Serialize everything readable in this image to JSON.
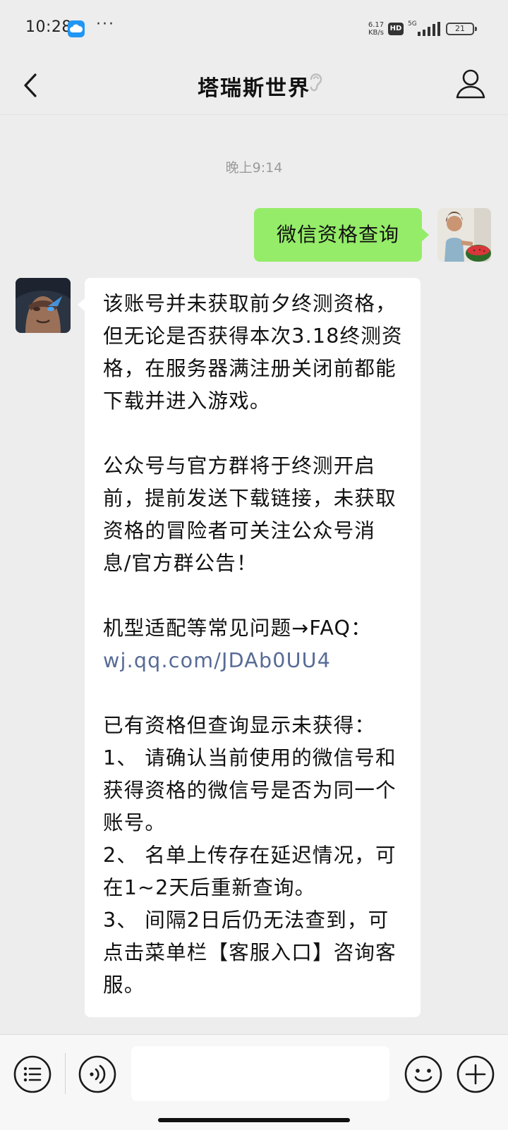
{
  "status_bar": {
    "time": "10:28",
    "more": "···",
    "net_speed_value": "6.17",
    "net_speed_unit": "KB/s",
    "hd": "HD",
    "network": "5G",
    "battery": "21"
  },
  "header": {
    "title": "塔瑞斯世界",
    "back_icon": "chevron-left-icon",
    "ear_icon": "ear-icon",
    "profile_icon": "person-icon"
  },
  "chat": {
    "timestamp": "晚上9:14",
    "outgoing": {
      "text": "微信资格查询"
    },
    "incoming": {
      "paragraphs": [
        "该账号并未获取前夕终测资格，但无论是否获得本次3.18终测资格，在服务器满注册关闭前都能下载并进入游戏。",
        "公众号与官方群将于终测开启前，提前发送下载链接，未获取资格的冒险者可关注公众号消息/官方群公告！",
        "机型适配等常见问题→FAQ："
      ],
      "link": "wj.qq.com/JDAb0UU4",
      "tips_title": "已有资格但查询显示未获得：",
      "tips": [
        "1、 请确认当前使用的微信号和获得资格的微信号是否为同一个账号。",
        "2、 名单上传存在延迟情况，可在1~2天后重新查询。",
        "3、 间隔2日后仍无法查到，可点击菜单栏【客服入口】咨询客服。"
      ]
    }
  },
  "input_bar": {
    "menu_icon": "list-menu-icon",
    "voice_icon": "voice-icon",
    "emoji_icon": "smiley-icon",
    "plus_icon": "plus-circle-icon",
    "input_value": ""
  }
}
